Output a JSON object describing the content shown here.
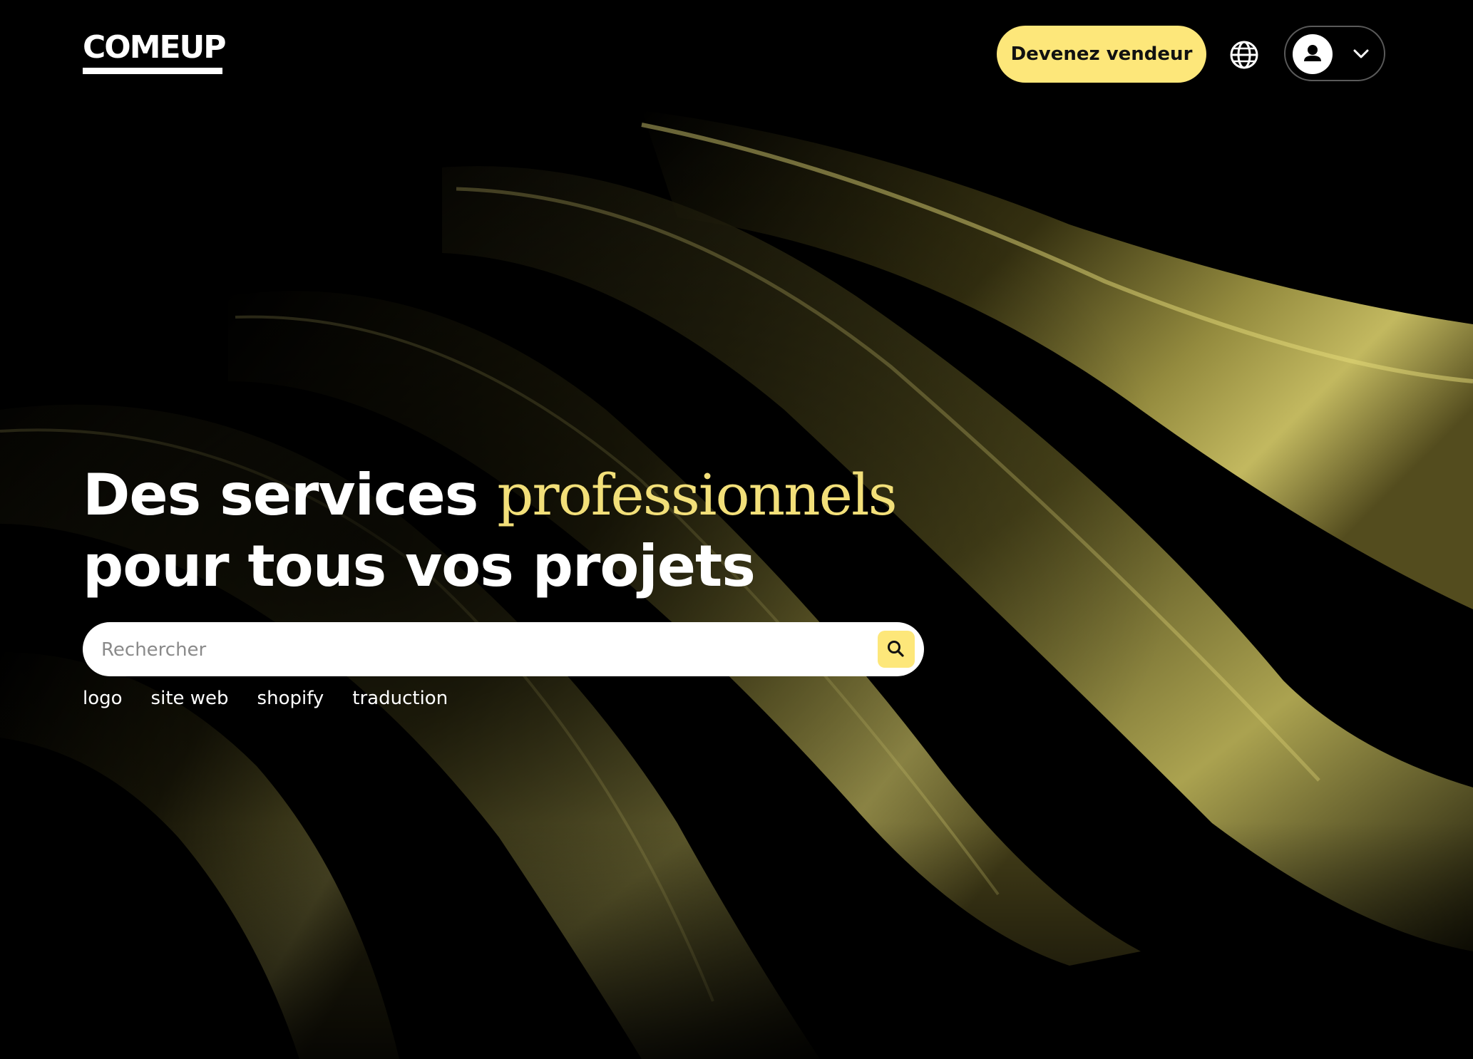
{
  "header": {
    "logo_text": "COMEUP",
    "seller_button_label": "Devenez vendeur",
    "language_icon": "globe-icon",
    "account_icon": "user-icon",
    "account_menu_icon": "chevron-down-icon"
  },
  "hero": {
    "headline_part1": "Des services ",
    "headline_accent": "professionnels",
    "headline_part2": "pour tous vos projets",
    "search": {
      "placeholder": "Rechercher",
      "value": "",
      "button_icon": "search-icon"
    },
    "tags": [
      "logo",
      "site web",
      "shopify",
      "traduction"
    ]
  },
  "colors": {
    "background": "#000000",
    "accent_yellow": "#fde77a",
    "headline_accent": "#f2df79",
    "text_white": "#ffffff"
  }
}
